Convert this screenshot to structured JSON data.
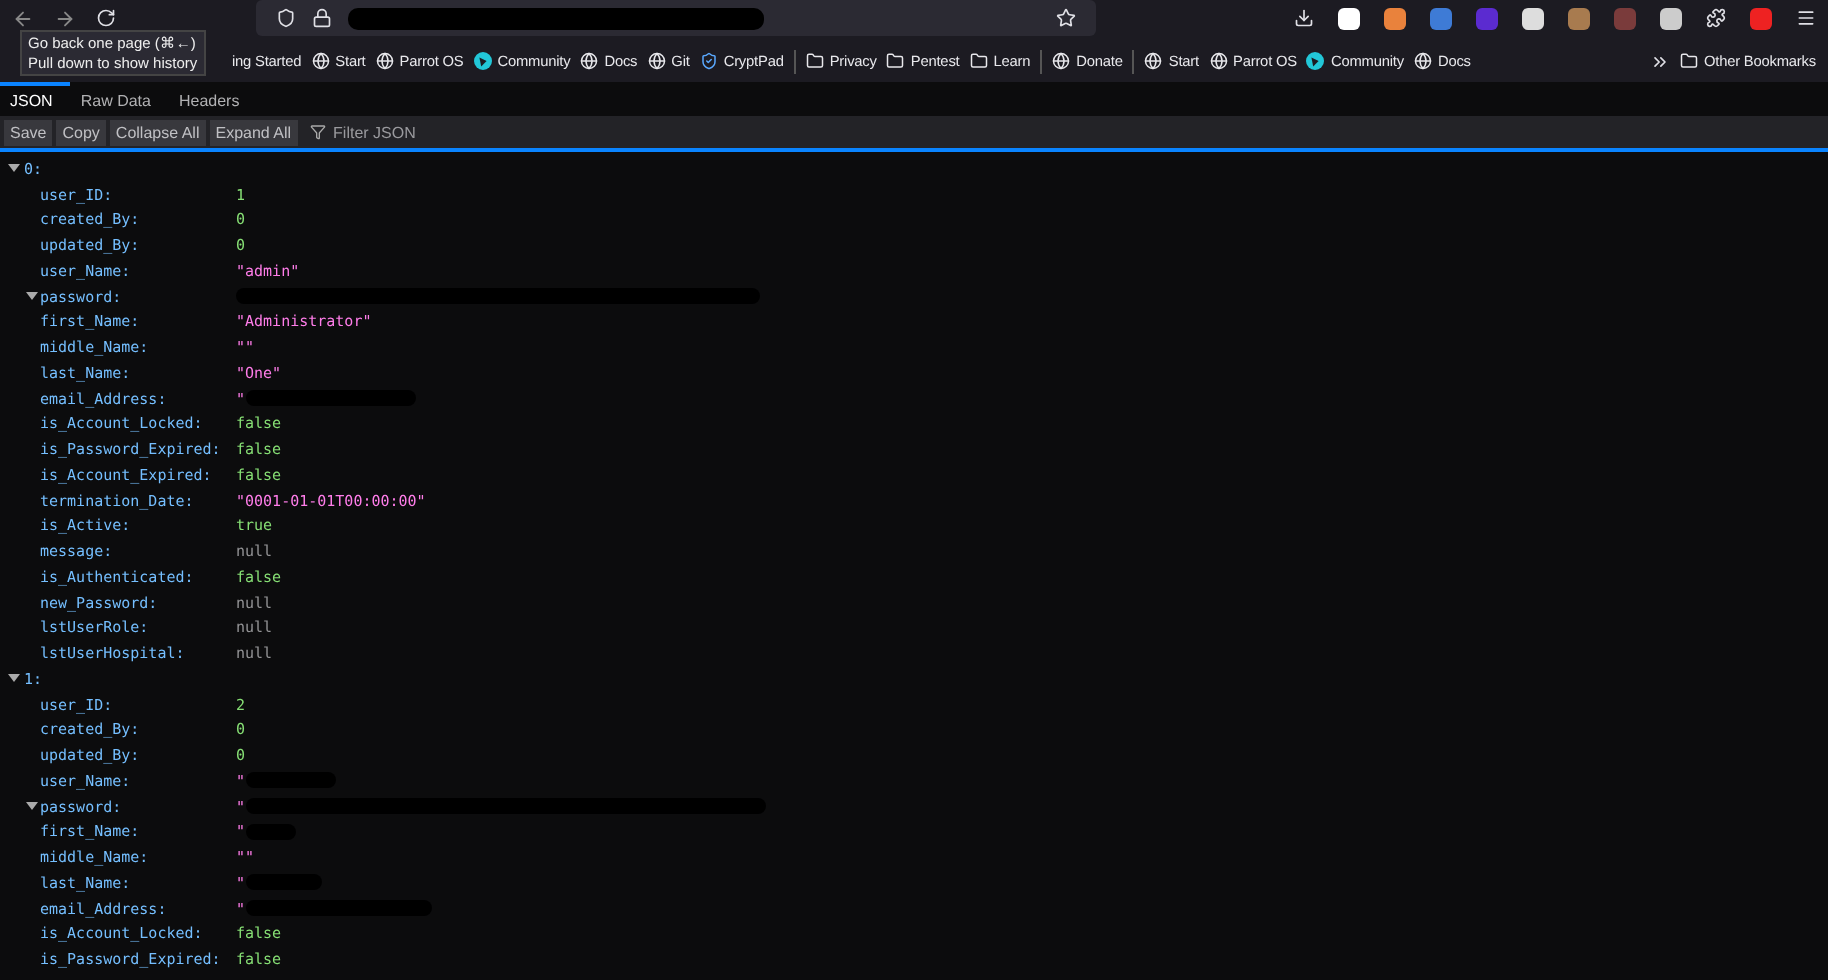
{
  "nav_tooltip": {
    "lines": [
      "Go back one page (⌘←)",
      "Pull down to show history"
    ]
  },
  "bookmarks": [
    {
      "label": "ing Started",
      "kind": "partial"
    },
    {
      "label": "Start",
      "kind": "site"
    },
    {
      "label": "Parrot OS",
      "kind": "site"
    },
    {
      "label": "Community",
      "kind": "app"
    },
    {
      "label": "Docs",
      "kind": "site"
    },
    {
      "label": "Git",
      "kind": "site"
    },
    {
      "label": "CryptPad",
      "kind": "secure"
    },
    {
      "label": "Privacy",
      "kind": "folder",
      "divider_before": true
    },
    {
      "label": "Pentest",
      "kind": "folder"
    },
    {
      "label": "Learn",
      "kind": "folder"
    },
    {
      "label": "Donate",
      "kind": "site",
      "divider_before": true
    },
    {
      "label": "Start",
      "kind": "site",
      "divider_before": true
    },
    {
      "label": "Parrot OS",
      "kind": "site"
    },
    {
      "label": "Community",
      "kind": "app"
    },
    {
      "label": "Docs",
      "kind": "site"
    }
  ],
  "other_bookmarks": "Other Bookmarks",
  "tabs": [
    {
      "label": "JSON",
      "selected": true
    },
    {
      "label": "Raw Data",
      "selected": false
    },
    {
      "label": "Headers",
      "selected": false
    }
  ],
  "buttons": [
    "Save",
    "Copy",
    "Collapse All",
    "Expand All"
  ],
  "filter": {
    "placeholder": "Filter JSON"
  },
  "records": [
    {
      "index": "0:",
      "expanded": true,
      "fields": [
        {
          "key": "user_ID:",
          "kind": "num",
          "value": "1"
        },
        {
          "key": "created_By:",
          "kind": "num",
          "value": "0"
        },
        {
          "key": "updated_By:",
          "kind": "num",
          "value": "0"
        },
        {
          "key": "user_Name:",
          "kind": "str",
          "value": "\"admin\""
        },
        {
          "key": "password:",
          "kind": "redacted",
          "expanded": true
        },
        {
          "key": "first_Name:",
          "kind": "str",
          "value": "\"Administrator\""
        },
        {
          "key": "middle_Name:",
          "kind": "str",
          "value": "\"\""
        },
        {
          "key": "last_Name:",
          "kind": "str",
          "value": "\"One\""
        },
        {
          "key": "email_Address:",
          "kind": "redacted",
          "value": "\""
        },
        {
          "key": "is_Account_Locked:",
          "kind": "bool",
          "value": "false"
        },
        {
          "key": "is_Password_Expired:",
          "kind": "bool",
          "value": "false"
        },
        {
          "key": "is_Account_Expired:",
          "kind": "bool",
          "value": "false"
        },
        {
          "key": "termination_Date:",
          "kind": "str",
          "value": "\"0001-01-01T00:00:00\""
        },
        {
          "key": "is_Active:",
          "kind": "bool",
          "value": "true"
        },
        {
          "key": "message:",
          "kind": "null",
          "value": "null"
        },
        {
          "key": "is_Authenticated:",
          "kind": "bool",
          "value": "false"
        },
        {
          "key": "new_Password:",
          "kind": "null",
          "value": "null"
        },
        {
          "key": "lstUserRole:",
          "kind": "null",
          "value": "null"
        },
        {
          "key": "lstUserHospital:",
          "kind": "null",
          "value": "null"
        }
      ]
    },
    {
      "index": "1:",
      "expanded": true,
      "fields": [
        {
          "key": "user_ID:",
          "kind": "num",
          "value": "2"
        },
        {
          "key": "created_By:",
          "kind": "num",
          "value": "0"
        },
        {
          "key": "updated_By:",
          "kind": "num",
          "value": "0"
        },
        {
          "key": "user_Name:",
          "kind": "redacted",
          "value": "\""
        },
        {
          "key": "password:",
          "kind": "redacted",
          "value": "\"",
          "expanded": true
        },
        {
          "key": "first_Name:",
          "kind": "redacted",
          "value": "\""
        },
        {
          "key": "middle_Name:",
          "kind": "str",
          "value": "\"\""
        },
        {
          "key": "last_Name:",
          "kind": "redacted",
          "value": "\""
        },
        {
          "key": "email_Address:",
          "kind": "redacted",
          "value": "\""
        },
        {
          "key": "is_Account_Locked:",
          "kind": "bool",
          "value": "false"
        },
        {
          "key": "is_Password_Expired:",
          "kind": "bool",
          "value": "false"
        }
      ]
    }
  ]
}
